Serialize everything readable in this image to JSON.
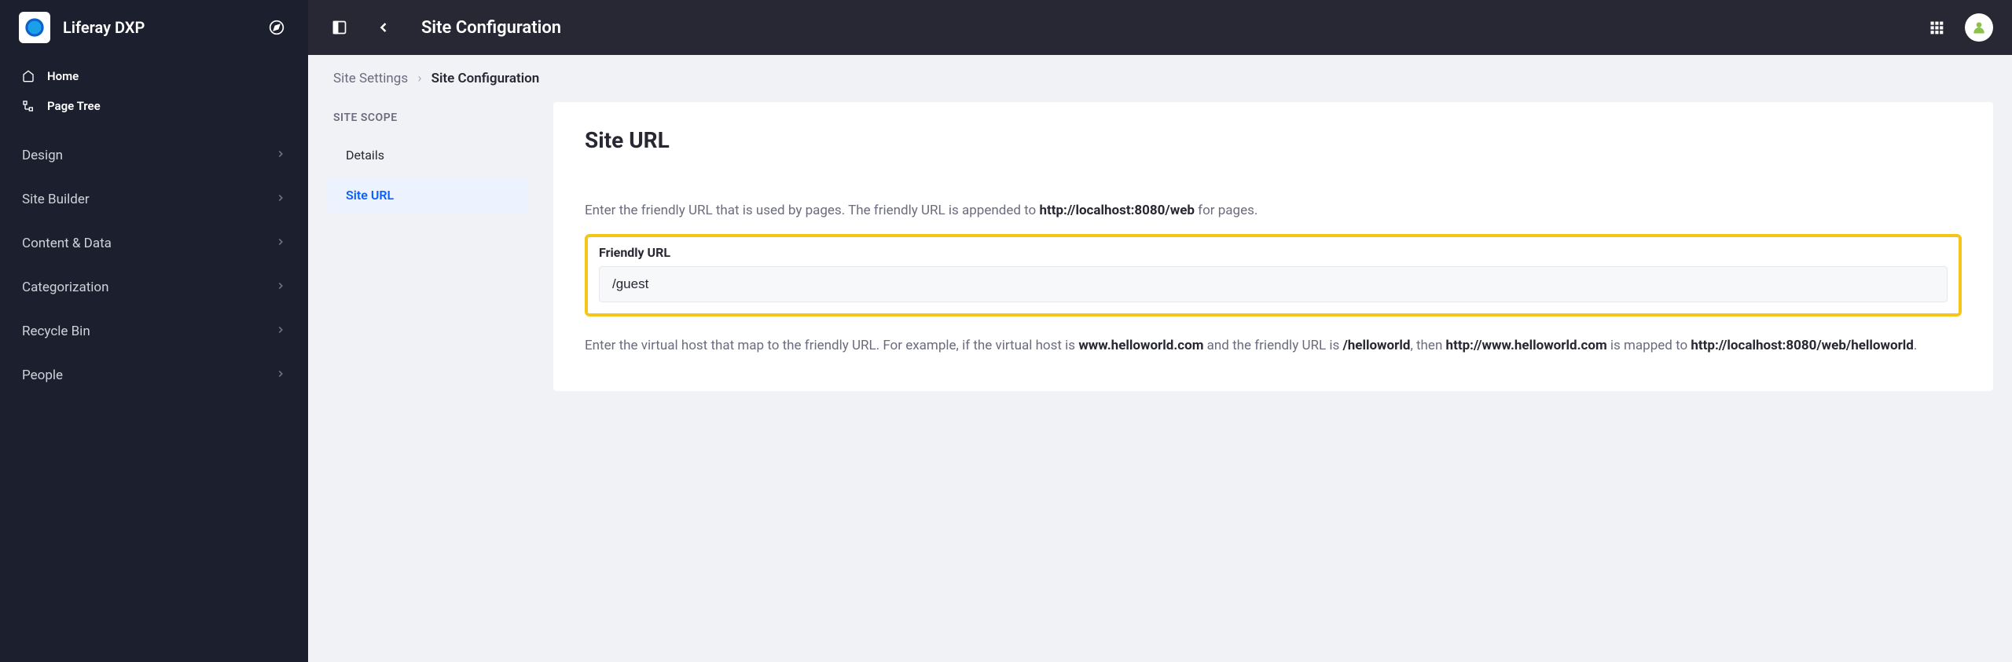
{
  "sidebar": {
    "title": "Liferay DXP",
    "items": [
      {
        "label": "Home"
      },
      {
        "label": "Page Tree"
      }
    ],
    "menu": [
      {
        "label": "Design"
      },
      {
        "label": "Site Builder"
      },
      {
        "label": "Content & Data"
      },
      {
        "label": "Categorization"
      },
      {
        "label": "Recycle Bin"
      },
      {
        "label": "People"
      }
    ]
  },
  "topbar": {
    "title": "Site Configuration"
  },
  "breadcrumb": {
    "parent": "Site Settings",
    "current": "Site Configuration"
  },
  "scope": {
    "label": "SITE SCOPE",
    "items": [
      {
        "label": "Details",
        "active": false
      },
      {
        "label": "Site URL",
        "active": true
      }
    ]
  },
  "panel": {
    "title": "Site URL",
    "desc1_pre": "Enter the friendly URL that is used by pages. The friendly URL is appended to ",
    "desc1_bold": "http://localhost:8080/web",
    "desc1_post": " for pages.",
    "field_label": "Friendly URL",
    "field_value": "/guest",
    "desc2_pre": "Enter the virtual host that map to the friendly URL. For example, if the virtual host is ",
    "desc2_b1": "www.helloworld.com",
    "desc2_mid1": " and the friendly URL is ",
    "desc2_b2": "/helloworld",
    "desc2_mid2": ", then ",
    "desc2_b3": "http://www.helloworld.com",
    "desc2_mid3": " is mapped to ",
    "desc2_b4": "http://localhost:8080/web/helloworld",
    "desc2_post": "."
  }
}
